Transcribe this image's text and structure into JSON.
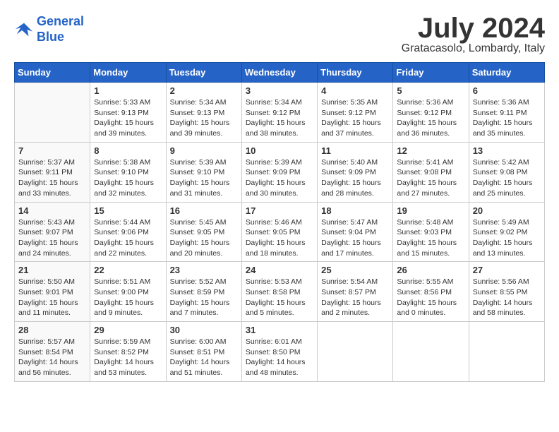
{
  "header": {
    "logo_line1": "General",
    "logo_line2": "Blue",
    "month": "July 2024",
    "location": "Gratacasolo, Lombardy, Italy"
  },
  "days_of_week": [
    "Sunday",
    "Monday",
    "Tuesday",
    "Wednesday",
    "Thursday",
    "Friday",
    "Saturday"
  ],
  "weeks": [
    [
      {
        "day": "",
        "info": ""
      },
      {
        "day": "1",
        "info": "Sunrise: 5:33 AM\nSunset: 9:13 PM\nDaylight: 15 hours\nand 39 minutes."
      },
      {
        "day": "2",
        "info": "Sunrise: 5:34 AM\nSunset: 9:13 PM\nDaylight: 15 hours\nand 39 minutes."
      },
      {
        "day": "3",
        "info": "Sunrise: 5:34 AM\nSunset: 9:12 PM\nDaylight: 15 hours\nand 38 minutes."
      },
      {
        "day": "4",
        "info": "Sunrise: 5:35 AM\nSunset: 9:12 PM\nDaylight: 15 hours\nand 37 minutes."
      },
      {
        "day": "5",
        "info": "Sunrise: 5:36 AM\nSunset: 9:12 PM\nDaylight: 15 hours\nand 36 minutes."
      },
      {
        "day": "6",
        "info": "Sunrise: 5:36 AM\nSunset: 9:11 PM\nDaylight: 15 hours\nand 35 minutes."
      }
    ],
    [
      {
        "day": "7",
        "info": "Sunrise: 5:37 AM\nSunset: 9:11 PM\nDaylight: 15 hours\nand 33 minutes."
      },
      {
        "day": "8",
        "info": "Sunrise: 5:38 AM\nSunset: 9:10 PM\nDaylight: 15 hours\nand 32 minutes."
      },
      {
        "day": "9",
        "info": "Sunrise: 5:39 AM\nSunset: 9:10 PM\nDaylight: 15 hours\nand 31 minutes."
      },
      {
        "day": "10",
        "info": "Sunrise: 5:39 AM\nSunset: 9:09 PM\nDaylight: 15 hours\nand 30 minutes."
      },
      {
        "day": "11",
        "info": "Sunrise: 5:40 AM\nSunset: 9:09 PM\nDaylight: 15 hours\nand 28 minutes."
      },
      {
        "day": "12",
        "info": "Sunrise: 5:41 AM\nSunset: 9:08 PM\nDaylight: 15 hours\nand 27 minutes."
      },
      {
        "day": "13",
        "info": "Sunrise: 5:42 AM\nSunset: 9:08 PM\nDaylight: 15 hours\nand 25 minutes."
      }
    ],
    [
      {
        "day": "14",
        "info": "Sunrise: 5:43 AM\nSunset: 9:07 PM\nDaylight: 15 hours\nand 24 minutes."
      },
      {
        "day": "15",
        "info": "Sunrise: 5:44 AM\nSunset: 9:06 PM\nDaylight: 15 hours\nand 22 minutes."
      },
      {
        "day": "16",
        "info": "Sunrise: 5:45 AM\nSunset: 9:05 PM\nDaylight: 15 hours\nand 20 minutes."
      },
      {
        "day": "17",
        "info": "Sunrise: 5:46 AM\nSunset: 9:05 PM\nDaylight: 15 hours\nand 18 minutes."
      },
      {
        "day": "18",
        "info": "Sunrise: 5:47 AM\nSunset: 9:04 PM\nDaylight: 15 hours\nand 17 minutes."
      },
      {
        "day": "19",
        "info": "Sunrise: 5:48 AM\nSunset: 9:03 PM\nDaylight: 15 hours\nand 15 minutes."
      },
      {
        "day": "20",
        "info": "Sunrise: 5:49 AM\nSunset: 9:02 PM\nDaylight: 15 hours\nand 13 minutes."
      }
    ],
    [
      {
        "day": "21",
        "info": "Sunrise: 5:50 AM\nSunset: 9:01 PM\nDaylight: 15 hours\nand 11 minutes."
      },
      {
        "day": "22",
        "info": "Sunrise: 5:51 AM\nSunset: 9:00 PM\nDaylight: 15 hours\nand 9 minutes."
      },
      {
        "day": "23",
        "info": "Sunrise: 5:52 AM\nSunset: 8:59 PM\nDaylight: 15 hours\nand 7 minutes."
      },
      {
        "day": "24",
        "info": "Sunrise: 5:53 AM\nSunset: 8:58 PM\nDaylight: 15 hours\nand 5 minutes."
      },
      {
        "day": "25",
        "info": "Sunrise: 5:54 AM\nSunset: 8:57 PM\nDaylight: 15 hours\nand 2 minutes."
      },
      {
        "day": "26",
        "info": "Sunrise: 5:55 AM\nSunset: 8:56 PM\nDaylight: 15 hours\nand 0 minutes."
      },
      {
        "day": "27",
        "info": "Sunrise: 5:56 AM\nSunset: 8:55 PM\nDaylight: 14 hours\nand 58 minutes."
      }
    ],
    [
      {
        "day": "28",
        "info": "Sunrise: 5:57 AM\nSunset: 8:54 PM\nDaylight: 14 hours\nand 56 minutes."
      },
      {
        "day": "29",
        "info": "Sunrise: 5:59 AM\nSunset: 8:52 PM\nDaylight: 14 hours\nand 53 minutes."
      },
      {
        "day": "30",
        "info": "Sunrise: 6:00 AM\nSunset: 8:51 PM\nDaylight: 14 hours\nand 51 minutes."
      },
      {
        "day": "31",
        "info": "Sunrise: 6:01 AM\nSunset: 8:50 PM\nDaylight: 14 hours\nand 48 minutes."
      },
      {
        "day": "",
        "info": ""
      },
      {
        "day": "",
        "info": ""
      },
      {
        "day": "",
        "info": ""
      }
    ]
  ]
}
